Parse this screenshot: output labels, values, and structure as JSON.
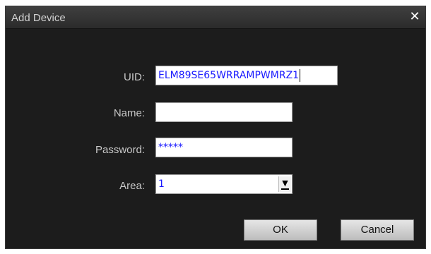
{
  "window": {
    "title": "Add Device",
    "close_icon": "✕"
  },
  "form": {
    "uid": {
      "label": "UID:",
      "value": "ELM89SE65WRRAMPWMRZ1"
    },
    "name": {
      "label": "Name:",
      "value": ""
    },
    "password": {
      "label": "Password:",
      "value": "*****"
    },
    "area": {
      "label": "Area:",
      "value": "1"
    }
  },
  "buttons": {
    "ok_label": "OK",
    "cancel_label": "Cancel"
  },
  "colors": {
    "dialog_bg": "#1c1c1c",
    "field_text": "#1a1aff",
    "label_text": "#c8c8c8"
  }
}
